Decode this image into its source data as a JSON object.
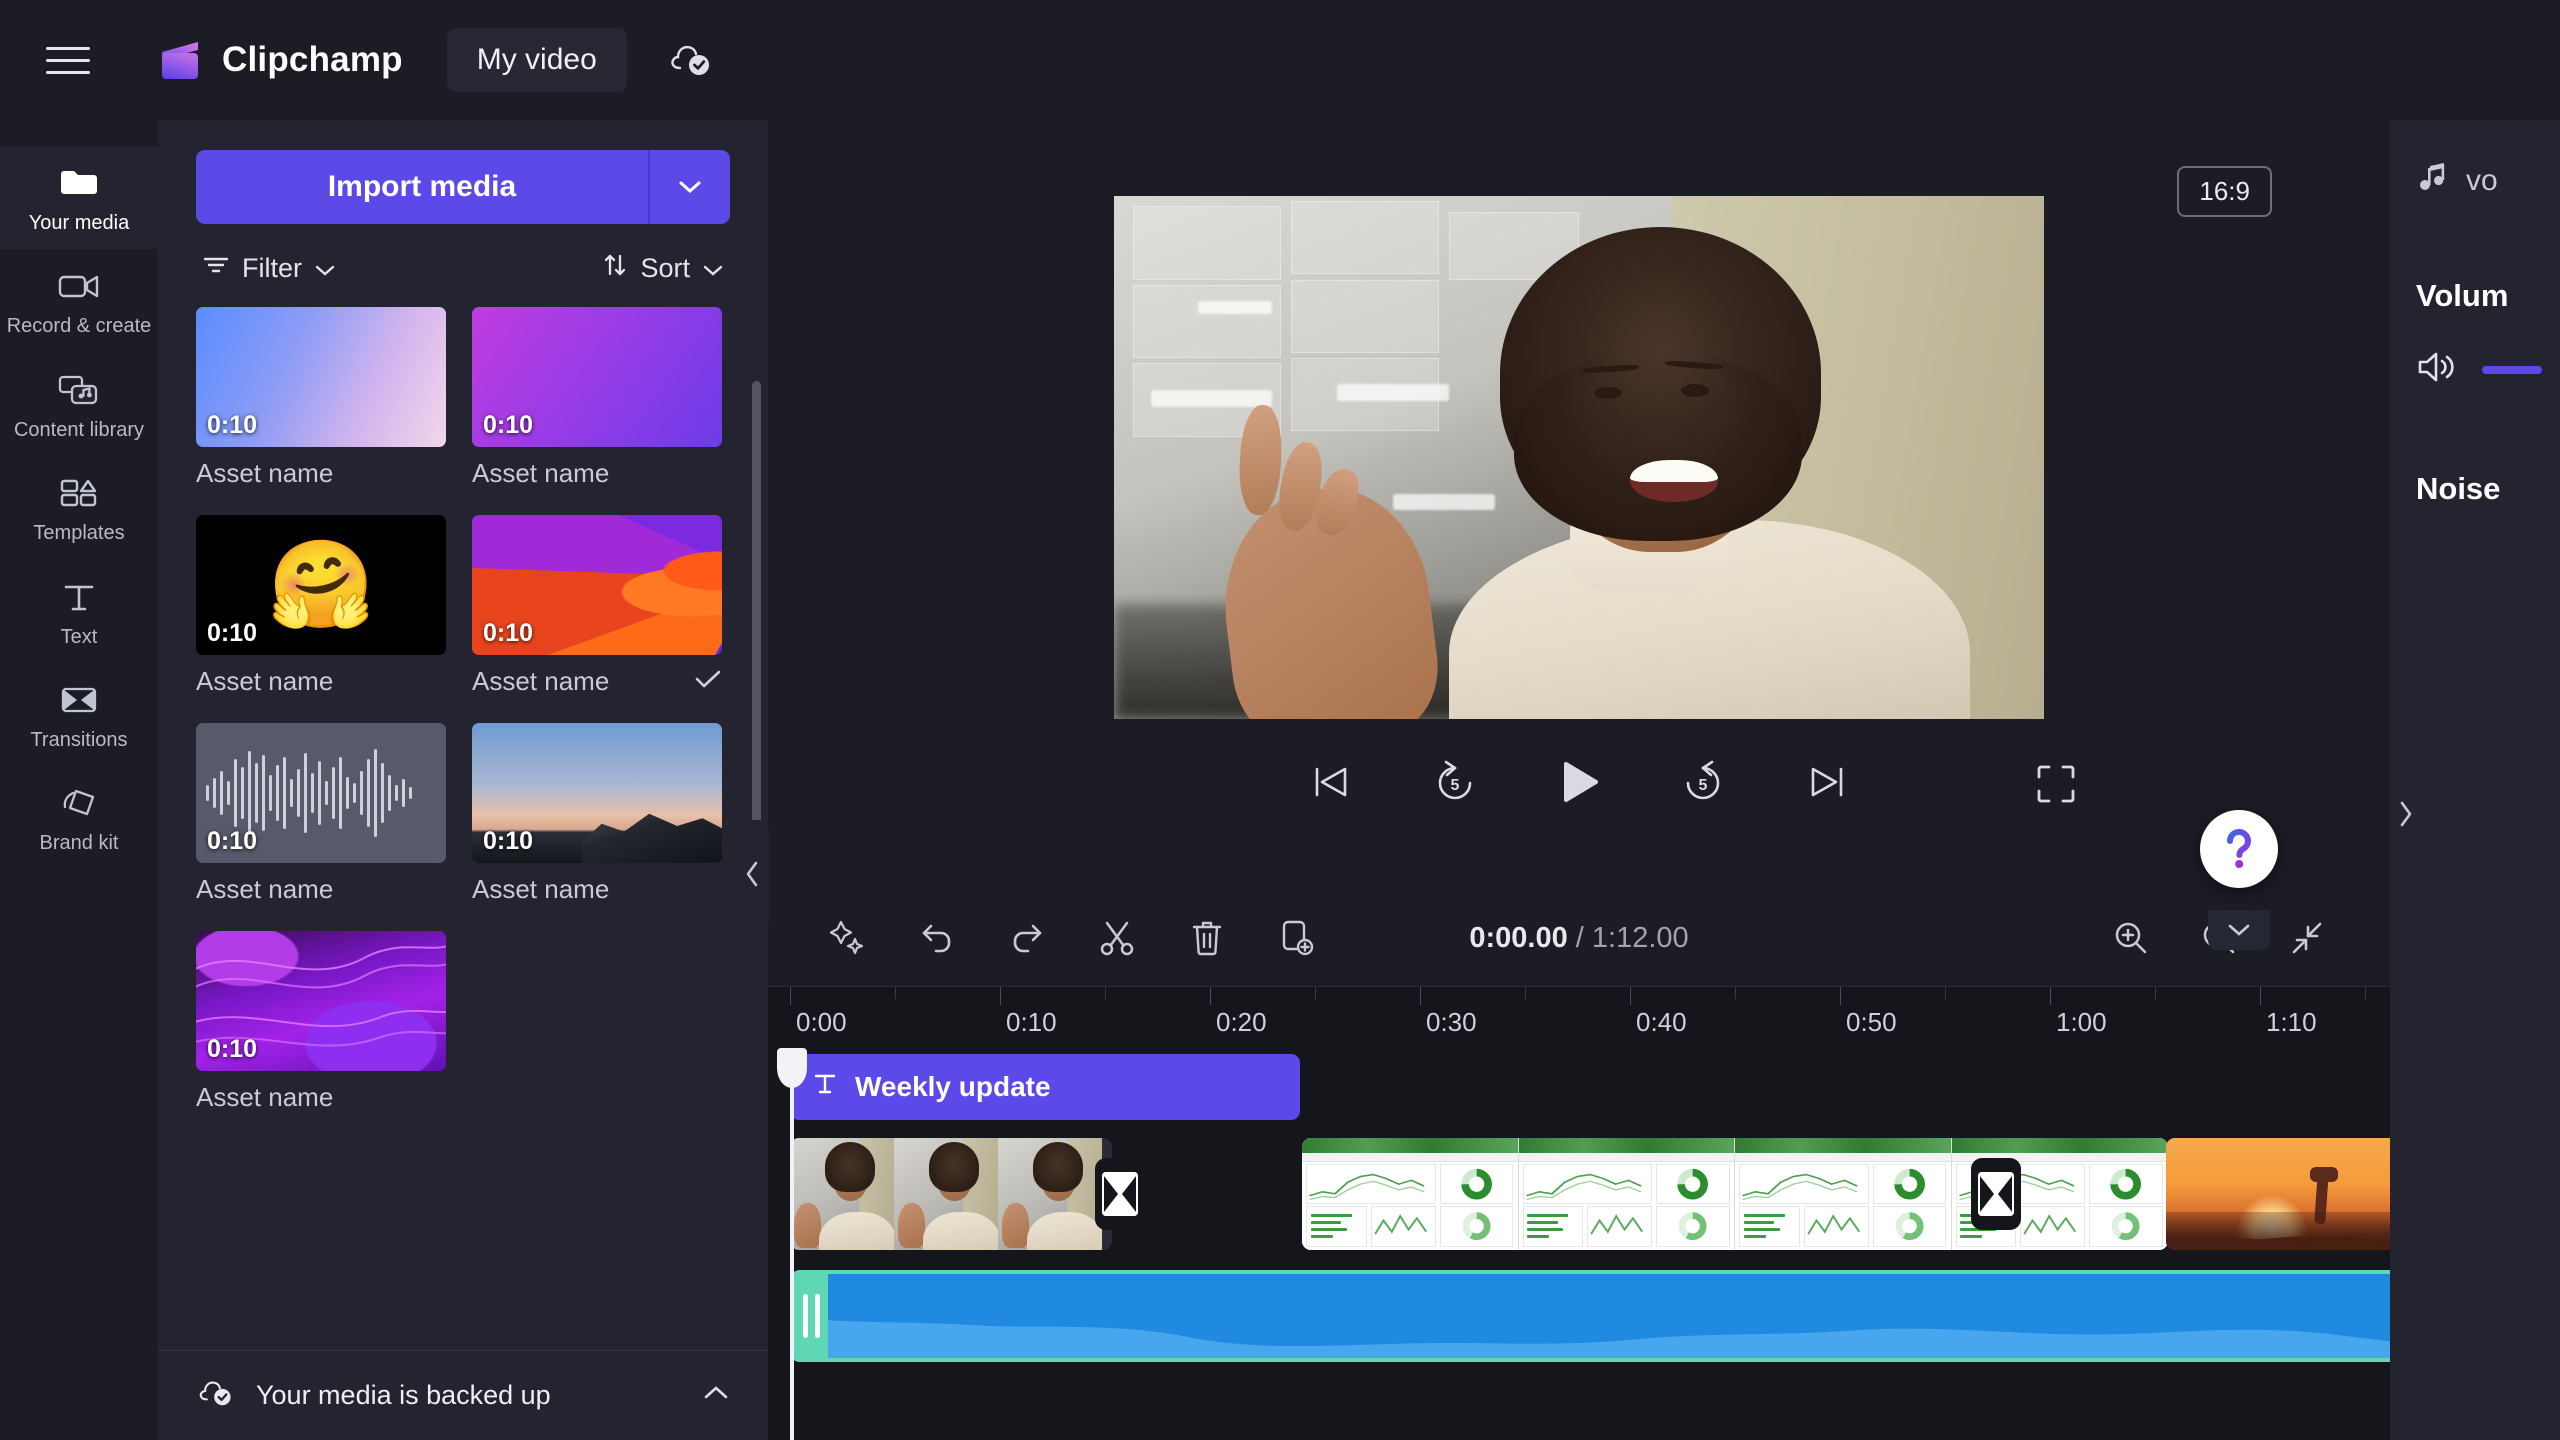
{
  "header": {
    "menu_icon": "hamburger-menu-icon",
    "logo_icon": "clipchamp-logo-icon",
    "brand": "Clipchamp",
    "project_title": "My video",
    "sync_icon": "cloud-check-icon"
  },
  "rail": {
    "items": [
      {
        "label": "Your media",
        "icon": "folder-icon",
        "active": true
      },
      {
        "label": "Record & create",
        "icon": "video-camera-icon",
        "active": false
      },
      {
        "label": "Content library",
        "icon": "content-library-icon",
        "active": false
      },
      {
        "label": "Templates",
        "icon": "templates-icon",
        "active": false
      },
      {
        "label": "Text",
        "icon": "text-t-icon",
        "active": false
      },
      {
        "label": "Transitions",
        "icon": "transitions-icon",
        "active": false
      },
      {
        "label": "Brand kit",
        "icon": "brand-kit-icon",
        "active": false
      }
    ]
  },
  "media_panel": {
    "import_label": "Import media",
    "import_caret_icon": "chevron-down-icon",
    "filter_label": "Filter",
    "filter_icon": "filter-icon",
    "sort_label": "Sort",
    "sort_icon": "sort-arrows-icon",
    "assets": [
      {
        "name": "Asset name",
        "duration": "0:10",
        "thumb": "gradient-blue-pink",
        "selected": false
      },
      {
        "name": "Asset name",
        "duration": "0:10",
        "thumb": "gradient-purple",
        "selected": false
      },
      {
        "name": "Asset name",
        "duration": "0:10",
        "thumb": "emoji-hugging-face",
        "selected": false
      },
      {
        "name": "Asset name",
        "duration": "0:10",
        "thumb": "abstract-purple-orange",
        "selected": true
      },
      {
        "name": "Asset name",
        "duration": "0:10",
        "thumb": "audio-waveform",
        "selected": false
      },
      {
        "name": "Asset name",
        "duration": "0:10",
        "thumb": "mountain-dusk",
        "selected": false
      },
      {
        "name": "Asset name",
        "duration": "0:10",
        "thumb": "neon-purple-wave",
        "selected": false
      }
    ],
    "selected_check_icon": "checkmark-icon",
    "backup_status": "Your media is backed up",
    "backup_icon": "cloud-check-icon",
    "backup_chevron_icon": "chevron-up-icon",
    "collapse_icon": "chevron-left-icon"
  },
  "stage": {
    "aspect_ratio": "16:9",
    "preview_alt": "Smiling woman with curly hair in cream turtleneck",
    "controls": [
      {
        "name": "skip-to-start-button",
        "icon": "skip-previous-icon"
      },
      {
        "name": "rewind-5s-button",
        "icon": "rewind-5-icon",
        "label": "5"
      },
      {
        "name": "play-button",
        "icon": "play-icon"
      },
      {
        "name": "forward-5s-button",
        "icon": "forward-5-icon",
        "label": "5"
      },
      {
        "name": "skip-to-end-button",
        "icon": "skip-next-icon"
      }
    ],
    "fullscreen_icon": "fullscreen-icon",
    "help_icon": "question-mark-icon",
    "help_chevron_icon": "chevron-down-icon"
  },
  "timeline": {
    "tools": [
      {
        "name": "magic-ai-button",
        "icon": "sparkle-icon"
      },
      {
        "name": "undo-button",
        "icon": "undo-arrow-icon"
      },
      {
        "name": "redo-button",
        "icon": "redo-arrow-icon"
      },
      {
        "name": "split-button",
        "icon": "scissors-icon"
      },
      {
        "name": "delete-button",
        "icon": "trash-icon"
      },
      {
        "name": "duplicate-button",
        "icon": "duplicate-icon"
      }
    ],
    "current_time": "0:00.00",
    "separator": "/",
    "total_time": "1:12.00",
    "zoom_controls": [
      {
        "name": "zoom-in-button",
        "icon": "zoom-in-icon"
      },
      {
        "name": "zoom-out-button",
        "icon": "zoom-out-icon"
      },
      {
        "name": "fit-to-screen-button",
        "icon": "fit-to-screen-icon"
      }
    ],
    "ruler_labels": [
      "0:00",
      "0:10",
      "0:20",
      "0:30",
      "0:40",
      "0:50",
      "1:00",
      "1:10"
    ],
    "playhead_position": "0:00",
    "clips": {
      "text_clip": {
        "label": "Weekly update",
        "icon": "text-t-icon"
      },
      "video_clip": {
        "name": "person-presenter-clip"
      },
      "dashboard_clip": {
        "name": "green-dashboard-clip"
      },
      "sunset_clip": {
        "name": "giraffe-sunset-clip"
      },
      "audio_clip": {
        "name": "music-audio-clip",
        "selected": true
      }
    },
    "transition_icon": "transition-bowtie-icon"
  },
  "properties": {
    "tab_label": "vo",
    "tab_icon": "music-note-icon",
    "volume_heading": "Volum",
    "speaker_icon": "speaker-volume-icon",
    "noise_heading": "Noise",
    "collapse_icon": "chevron-right-icon"
  },
  "colors": {
    "accent_purple": "#5b4ae8",
    "panel_bg": "#23242f",
    "app_bg": "#15161c",
    "header_bg": "#1b1c24",
    "audio_blue": "#1f8ae0",
    "audio_select": "#5fd6b4",
    "dashboard_green": "#3d9a40"
  }
}
